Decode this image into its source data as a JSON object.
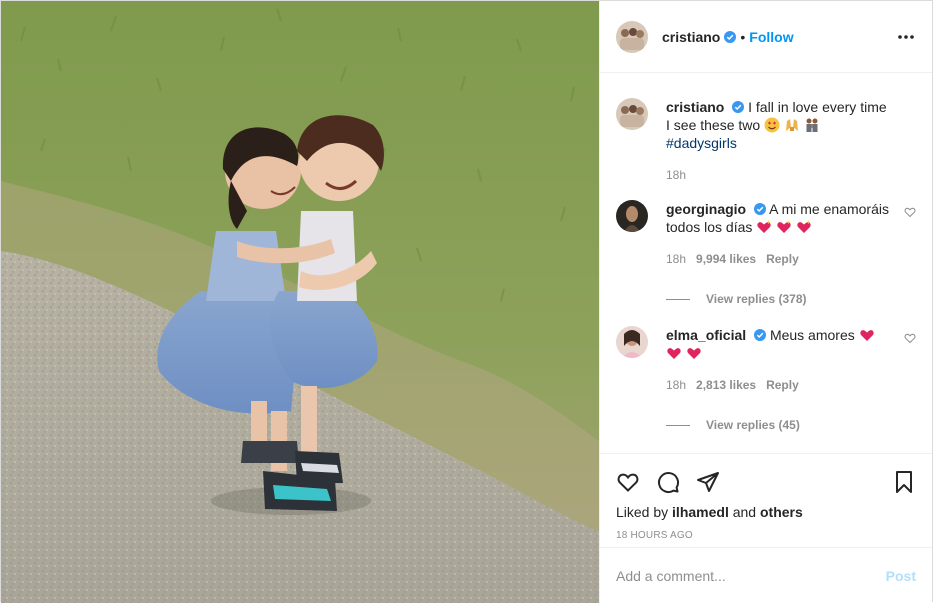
{
  "post": {
    "author": "cristiano",
    "follow_label": "Follow",
    "separator": "•",
    "more_icon": "more-horizontal-icon",
    "photo_alt": "Two little girls in blue tutus hugging on a gravel path"
  },
  "caption": {
    "username": "cristiano",
    "text": "I fall in love every time I see these two",
    "hashtag": "#dadysgirls",
    "time": "18h"
  },
  "comments": [
    {
      "username": "georginagio",
      "text": "A mi me enamoráis todos los días",
      "time": "18h",
      "likes": "9,994 likes",
      "reply_label": "Reply",
      "view_replies": "View replies (378)"
    },
    {
      "username": "elma_oficial",
      "text": "Meus amores",
      "time": "18h",
      "likes": "2,813 likes",
      "reply_label": "Reply",
      "view_replies": "View replies (45)"
    }
  ],
  "actions": {
    "liked_by_prefix": "Liked by",
    "liked_by_user": "ilhamedl",
    "liked_by_and": "and",
    "liked_by_others": "others",
    "timestamp": "18 HOURS AGO"
  },
  "add_comment": {
    "placeholder": "Add a comment...",
    "post_label": "Post"
  },
  "colors": {
    "accent": "#0095f6",
    "verified": "#3897f0",
    "muted": "#8e8e8e",
    "post_disabled": "#b2dffc"
  }
}
